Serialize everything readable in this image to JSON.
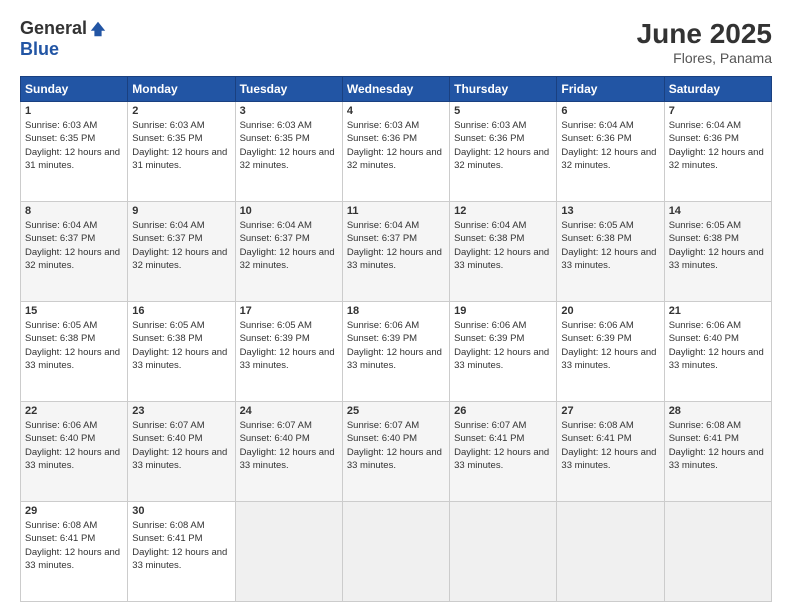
{
  "header": {
    "logo_general": "General",
    "logo_blue": "Blue",
    "month_title": "June 2025",
    "location": "Flores, Panama"
  },
  "weekdays": [
    "Sunday",
    "Monday",
    "Tuesday",
    "Wednesday",
    "Thursday",
    "Friday",
    "Saturday"
  ],
  "weeks": [
    [
      {
        "day": "1",
        "sunrise": "6:03 AM",
        "sunset": "6:35 PM",
        "daylight": "12 hours and 31 minutes."
      },
      {
        "day": "2",
        "sunrise": "6:03 AM",
        "sunset": "6:35 PM",
        "daylight": "12 hours and 31 minutes."
      },
      {
        "day": "3",
        "sunrise": "6:03 AM",
        "sunset": "6:35 PM",
        "daylight": "12 hours and 32 minutes."
      },
      {
        "day": "4",
        "sunrise": "6:03 AM",
        "sunset": "6:36 PM",
        "daylight": "12 hours and 32 minutes."
      },
      {
        "day": "5",
        "sunrise": "6:03 AM",
        "sunset": "6:36 PM",
        "daylight": "12 hours and 32 minutes."
      },
      {
        "day": "6",
        "sunrise": "6:04 AM",
        "sunset": "6:36 PM",
        "daylight": "12 hours and 32 minutes."
      },
      {
        "day": "7",
        "sunrise": "6:04 AM",
        "sunset": "6:36 PM",
        "daylight": "12 hours and 32 minutes."
      }
    ],
    [
      {
        "day": "8",
        "sunrise": "6:04 AM",
        "sunset": "6:37 PM",
        "daylight": "12 hours and 32 minutes."
      },
      {
        "day": "9",
        "sunrise": "6:04 AM",
        "sunset": "6:37 PM",
        "daylight": "12 hours and 32 minutes."
      },
      {
        "day": "10",
        "sunrise": "6:04 AM",
        "sunset": "6:37 PM",
        "daylight": "12 hours and 32 minutes."
      },
      {
        "day": "11",
        "sunrise": "6:04 AM",
        "sunset": "6:37 PM",
        "daylight": "12 hours and 33 minutes."
      },
      {
        "day": "12",
        "sunrise": "6:04 AM",
        "sunset": "6:38 PM",
        "daylight": "12 hours and 33 minutes."
      },
      {
        "day": "13",
        "sunrise": "6:05 AM",
        "sunset": "6:38 PM",
        "daylight": "12 hours and 33 minutes."
      },
      {
        "day": "14",
        "sunrise": "6:05 AM",
        "sunset": "6:38 PM",
        "daylight": "12 hours and 33 minutes."
      }
    ],
    [
      {
        "day": "15",
        "sunrise": "6:05 AM",
        "sunset": "6:38 PM",
        "daylight": "12 hours and 33 minutes."
      },
      {
        "day": "16",
        "sunrise": "6:05 AM",
        "sunset": "6:38 PM",
        "daylight": "12 hours and 33 minutes."
      },
      {
        "day": "17",
        "sunrise": "6:05 AM",
        "sunset": "6:39 PM",
        "daylight": "12 hours and 33 minutes."
      },
      {
        "day": "18",
        "sunrise": "6:06 AM",
        "sunset": "6:39 PM",
        "daylight": "12 hours and 33 minutes."
      },
      {
        "day": "19",
        "sunrise": "6:06 AM",
        "sunset": "6:39 PM",
        "daylight": "12 hours and 33 minutes."
      },
      {
        "day": "20",
        "sunrise": "6:06 AM",
        "sunset": "6:39 PM",
        "daylight": "12 hours and 33 minutes."
      },
      {
        "day": "21",
        "sunrise": "6:06 AM",
        "sunset": "6:40 PM",
        "daylight": "12 hours and 33 minutes."
      }
    ],
    [
      {
        "day": "22",
        "sunrise": "6:06 AM",
        "sunset": "6:40 PM",
        "daylight": "12 hours and 33 minutes."
      },
      {
        "day": "23",
        "sunrise": "6:07 AM",
        "sunset": "6:40 PM",
        "daylight": "12 hours and 33 minutes."
      },
      {
        "day": "24",
        "sunrise": "6:07 AM",
        "sunset": "6:40 PM",
        "daylight": "12 hours and 33 minutes."
      },
      {
        "day": "25",
        "sunrise": "6:07 AM",
        "sunset": "6:40 PM",
        "daylight": "12 hours and 33 minutes."
      },
      {
        "day": "26",
        "sunrise": "6:07 AM",
        "sunset": "6:41 PM",
        "daylight": "12 hours and 33 minutes."
      },
      {
        "day": "27",
        "sunrise": "6:08 AM",
        "sunset": "6:41 PM",
        "daylight": "12 hours and 33 minutes."
      },
      {
        "day": "28",
        "sunrise": "6:08 AM",
        "sunset": "6:41 PM",
        "daylight": "12 hours and 33 minutes."
      }
    ],
    [
      {
        "day": "29",
        "sunrise": "6:08 AM",
        "sunset": "6:41 PM",
        "daylight": "12 hours and 33 minutes."
      },
      {
        "day": "30",
        "sunrise": "6:08 AM",
        "sunset": "6:41 PM",
        "daylight": "12 hours and 33 minutes."
      },
      null,
      null,
      null,
      null,
      null
    ]
  ]
}
